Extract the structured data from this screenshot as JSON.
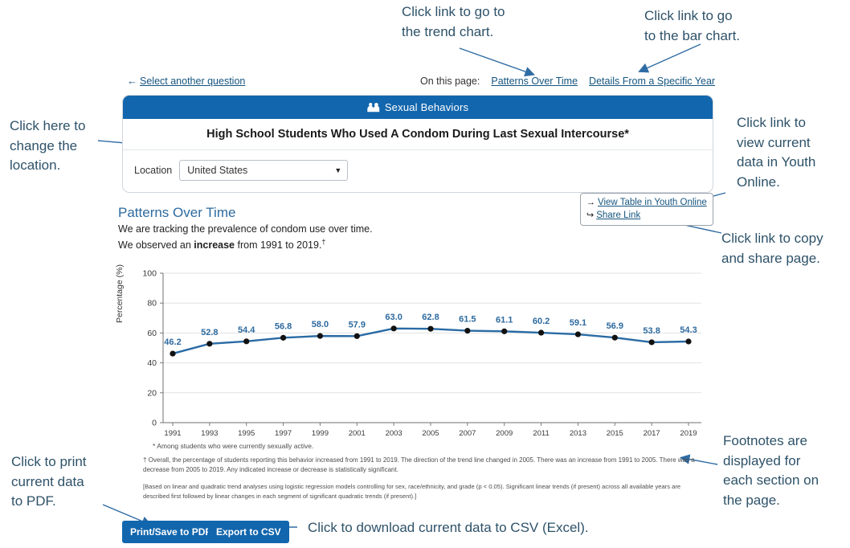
{
  "annotations": [
    {
      "id": "trend-chart-note",
      "text": "Click link to go to\nthe trend chart."
    },
    {
      "id": "bar-chart-note",
      "text": "Click link to go\nto the bar chart."
    },
    {
      "id": "location-note",
      "text": "Click here to\nchange the\nlocation."
    },
    {
      "id": "youth-online-note",
      "text": "Click link to\nview current\ndata in Youth\nOnline."
    },
    {
      "id": "share-note",
      "text": "Click link to copy\nand share page."
    },
    {
      "id": "footnote-note",
      "text": "Footnotes are\ndisplayed for\neach section on\nthe page."
    },
    {
      "id": "print-note",
      "text": "Click to print\ncurrent data\nto PDF."
    },
    {
      "id": "csv-note",
      "text": "Click to download current data to CSV (Excel)."
    }
  ],
  "topnav": {
    "back_arrow": "←",
    "back_label": "Select another question",
    "on_this_page_label": "On this page:",
    "links": [
      {
        "label": "Patterns Over Time"
      },
      {
        "label": "Details From a Specific Year"
      }
    ]
  },
  "card": {
    "header_icon": "people-icon",
    "header_label": "Sexual Behaviors",
    "title": "High School Students Who Used A Condom During Last Sexual Intercourse*",
    "location_label": "Location",
    "location_value": "United States",
    "location_caret": "▼"
  },
  "linkbox": {
    "items": [
      {
        "icon": "→",
        "icon_name": "arrow-right-icon",
        "label": "View Table in Youth Online"
      },
      {
        "icon": "↪",
        "icon_name": "share-icon",
        "label": "Share Link"
      }
    ]
  },
  "section": {
    "title": "Patterns Over Time",
    "line1": "We are tracking the prevalence of condom use over time.",
    "line2_pre": "We observed an ",
    "line2_bold": "increase",
    "line2_post": " from 1991 to 2019.",
    "line2_sup": "†"
  },
  "footnotes": {
    "fn1": "* Among students who were currently sexually active.",
    "fn2": "† Overall, the percentage of students reporting this behavior increased from 1991 to 2019. The direction of the trend line changed in 2005. There was an increase from 1991 to 2005. There was a decrease from 2005 to 2019. Any indicated increase or decrease is statistically significant.",
    "fn3": "[Based on linear and quadratic trend analyses using logistic regression models controlling for sex, race/ethnicity, and grade (p < 0.05). Significant linear trends (if present) across all available years are described first followed by linear changes in each segment of significant quadratic trends (if present).]"
  },
  "buttons": {
    "pdf": "Print/Save to PDF",
    "csv": "Export to CSV"
  },
  "colors": {
    "brand_blue": "#1266ad",
    "line_blue": "#2a6ba5",
    "label_blue": "#2d6a9f",
    "annotation": "#2e5269",
    "link": "#15557f"
  },
  "chart_data": {
    "type": "line",
    "title": "",
    "xlabel": "",
    "ylabel": "Percentage (%)",
    "ylim": [
      0,
      100
    ],
    "yticks": [
      0,
      20,
      40,
      60,
      80,
      100
    ],
    "grid": true,
    "legend": "none",
    "categories": [
      1991,
      1993,
      1995,
      1997,
      1999,
      2001,
      2003,
      2005,
      2007,
      2009,
      2011,
      2013,
      2015,
      2017,
      2019
    ],
    "values": [
      46.2,
      52.8,
      54.4,
      56.8,
      58.0,
      57.9,
      63.0,
      62.8,
      61.5,
      61.1,
      60.2,
      59.1,
      56.9,
      53.8,
      54.3
    ],
    "point_labels": [
      "46.2",
      "52.8",
      "54.4",
      "56.8",
      "58.0",
      "57.9",
      "63.0",
      "62.8",
      "61.5",
      "61.1",
      "60.2",
      "59.1",
      "56.9",
      "53.8",
      "54.3"
    ]
  }
}
